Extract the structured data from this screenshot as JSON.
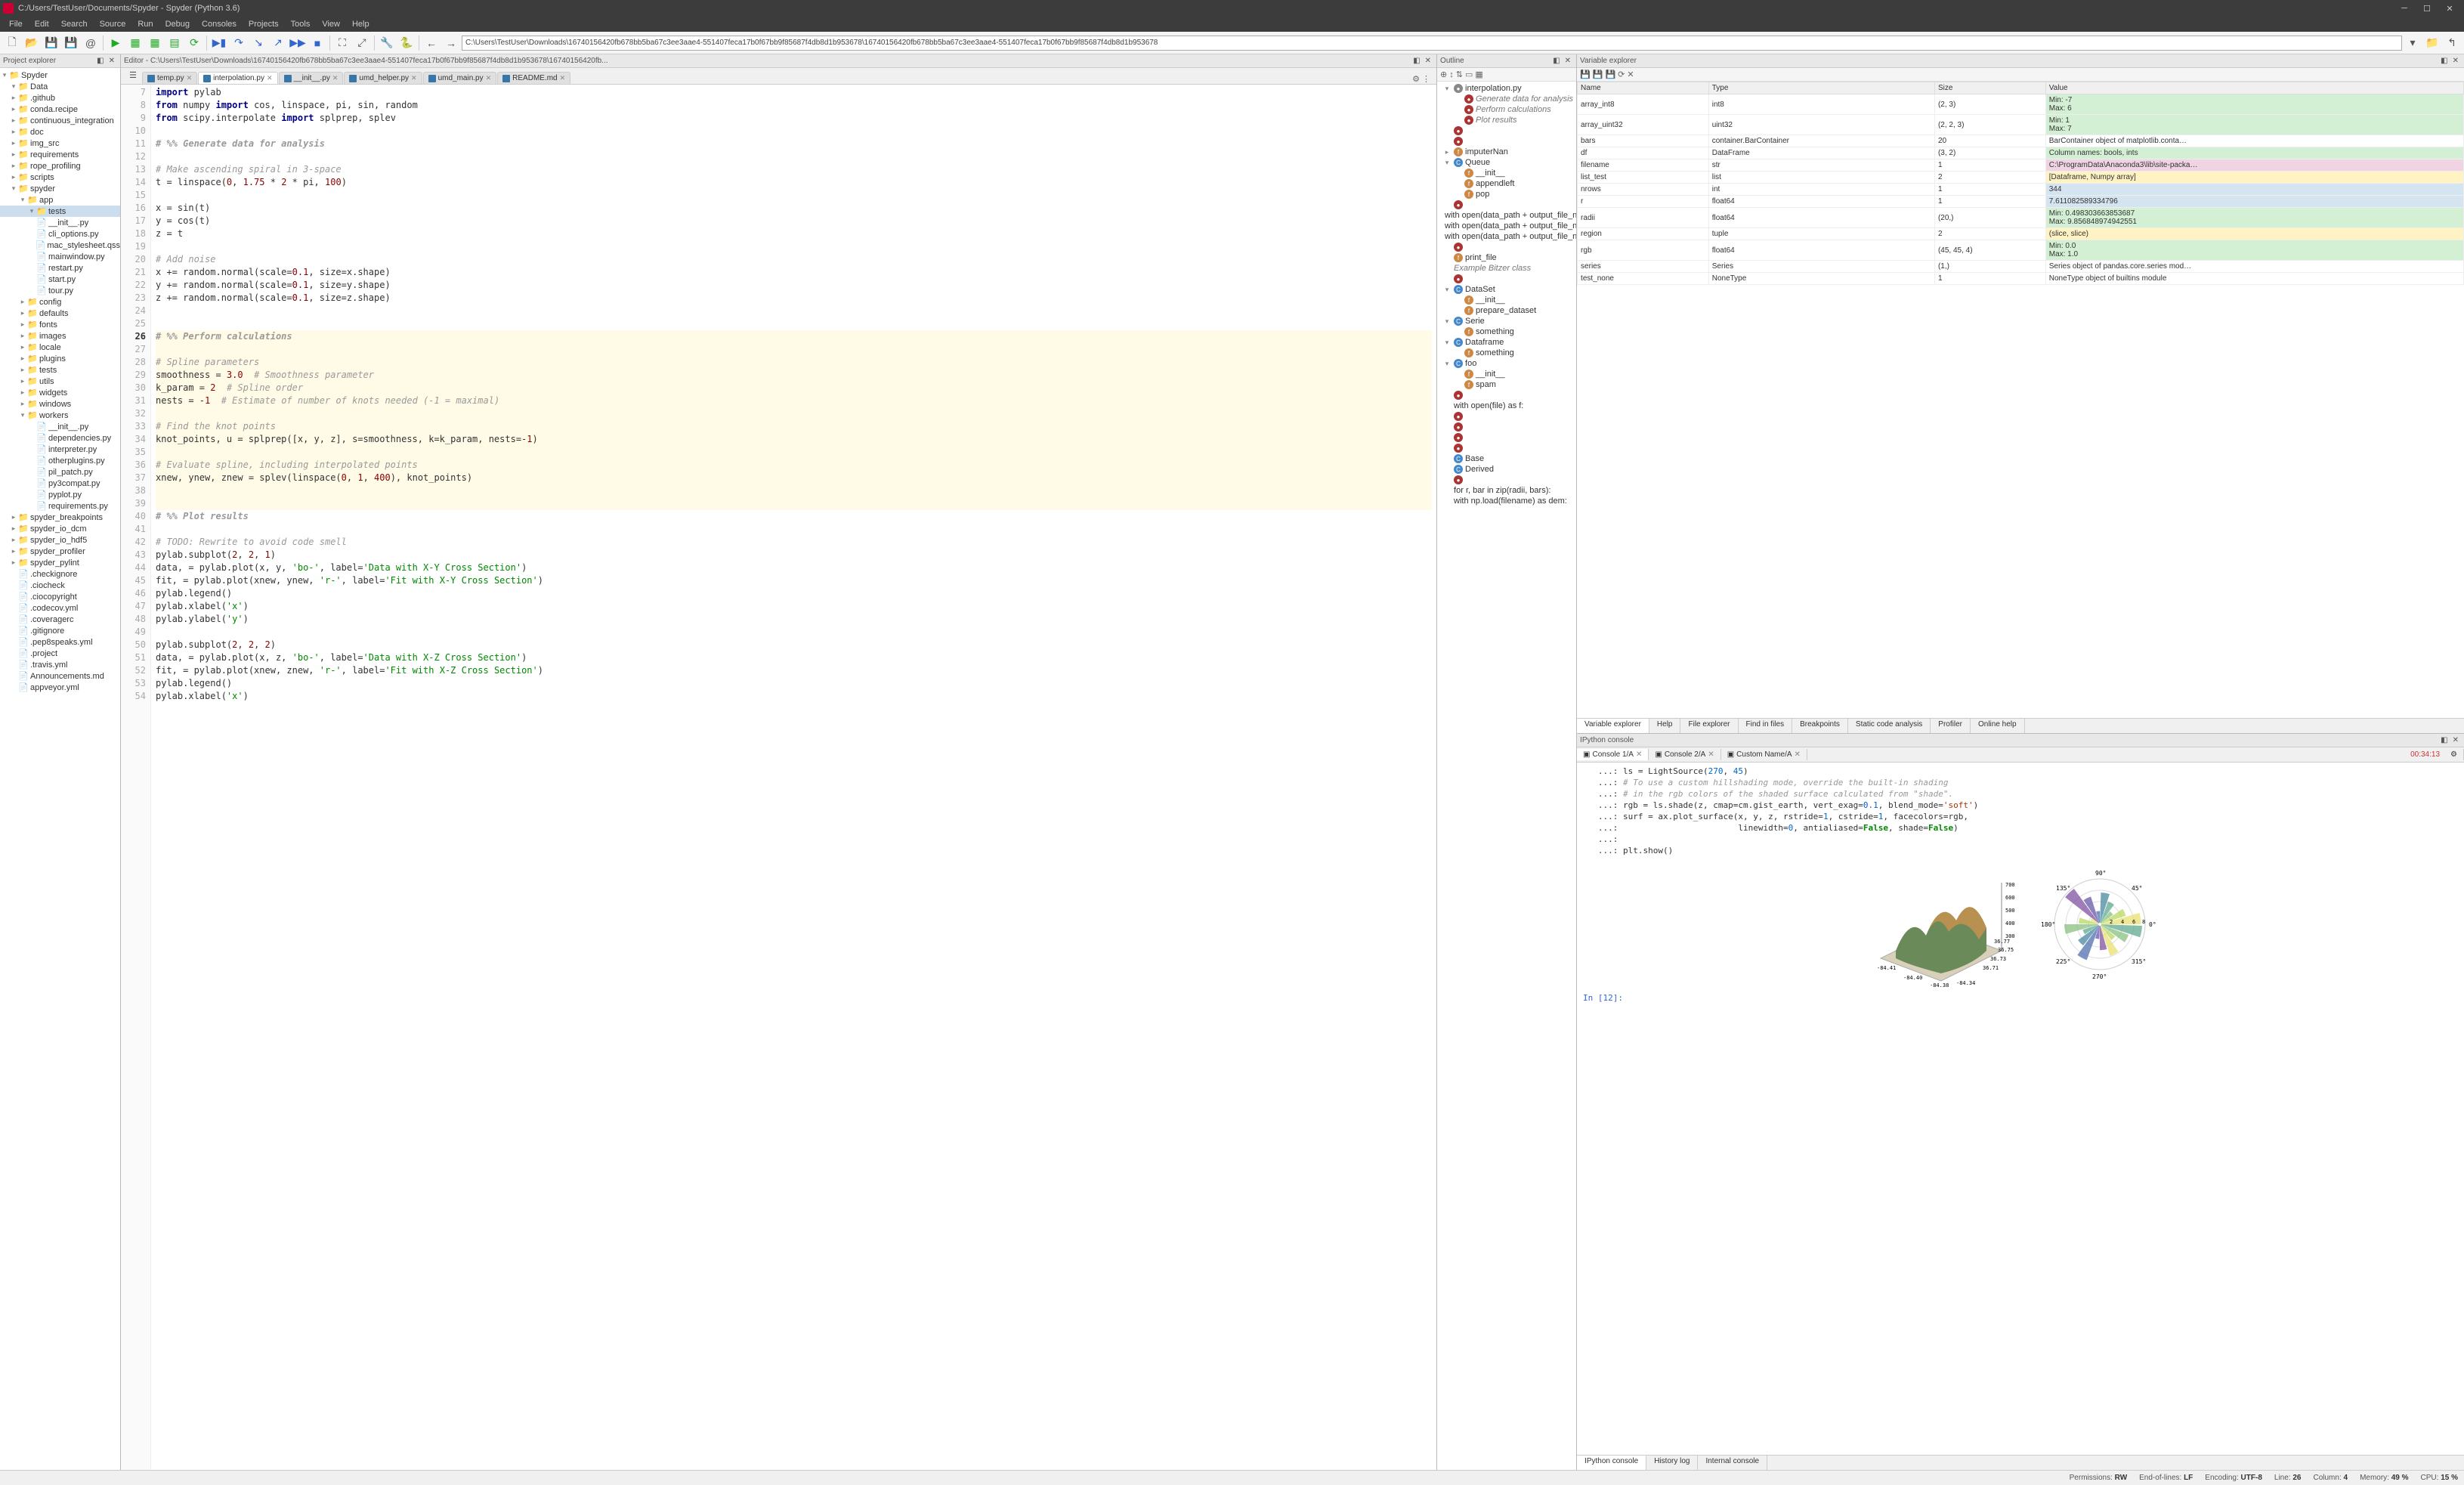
{
  "title": "C:/Users/TestUser/Documents/Spyder - Spyder (Python 3.6)",
  "menus": [
    "File",
    "Edit",
    "Search",
    "Source",
    "Run",
    "Debug",
    "Consoles",
    "Projects",
    "Tools",
    "View",
    "Help"
  ],
  "address": "C:\\Users\\TestUser\\Downloads\\16740156420fb678bb5ba67c3ee3aae4-551407feca17b0f67bb9f85687f4db8d1b953678\\16740156420fb678bb5ba67c3ee3aae4-551407feca17b0f67bb9f85687f4db8d1b953678",
  "panes": {
    "project": "Project explorer",
    "editor": "Editor - C:\\Users\\TestUser\\Downloads\\16740156420fb678bb5ba67c3ee3aae4-551407feca17b0f67bb9f85687f4db8d1b953678\\16740156420fb...",
    "outline": "Outline",
    "varexp": "Variable explorer",
    "ipython": "IPython console"
  },
  "project_tree": [
    {
      "d": 0,
      "exp": "▾",
      "icon": "folder",
      "label": "Spyder"
    },
    {
      "d": 1,
      "exp": "▾",
      "icon": "folder",
      "label": "Data"
    },
    {
      "d": 1,
      "exp": "▸",
      "icon": "folder",
      "label": ".github"
    },
    {
      "d": 1,
      "exp": "▸",
      "icon": "folder",
      "label": "conda.recipe"
    },
    {
      "d": 1,
      "exp": "▸",
      "icon": "folder",
      "label": "continuous_integration"
    },
    {
      "d": 1,
      "exp": "▸",
      "icon": "folder",
      "label": "doc"
    },
    {
      "d": 1,
      "exp": "▸",
      "icon": "folder",
      "label": "img_src"
    },
    {
      "d": 1,
      "exp": "▸",
      "icon": "folder",
      "label": "requirements"
    },
    {
      "d": 1,
      "exp": "▸",
      "icon": "folder",
      "label": "rope_profiling"
    },
    {
      "d": 1,
      "exp": "▸",
      "icon": "folder",
      "label": "scripts"
    },
    {
      "d": 1,
      "exp": "▾",
      "icon": "folder",
      "label": "spyder"
    },
    {
      "d": 2,
      "exp": "▾",
      "icon": "folder",
      "label": "app"
    },
    {
      "d": 3,
      "exp": "▾",
      "icon": "folder",
      "label": "tests",
      "sel": true
    },
    {
      "d": 3,
      "exp": "",
      "icon": "py",
      "label": "__init__.py"
    },
    {
      "d": 3,
      "exp": "",
      "icon": "py",
      "label": "cli_options.py"
    },
    {
      "d": 3,
      "exp": "",
      "icon": "file",
      "label": "mac_stylesheet.qss"
    },
    {
      "d": 3,
      "exp": "",
      "icon": "py",
      "label": "mainwindow.py"
    },
    {
      "d": 3,
      "exp": "",
      "icon": "py",
      "label": "restart.py"
    },
    {
      "d": 3,
      "exp": "",
      "icon": "py",
      "label": "start.py"
    },
    {
      "d": 3,
      "exp": "",
      "icon": "py",
      "label": "tour.py"
    },
    {
      "d": 2,
      "exp": "▸",
      "icon": "folder",
      "label": "config"
    },
    {
      "d": 2,
      "exp": "▸",
      "icon": "folder",
      "label": "defaults"
    },
    {
      "d": 2,
      "exp": "▸",
      "icon": "folder",
      "label": "fonts"
    },
    {
      "d": 2,
      "exp": "▸",
      "icon": "folder",
      "label": "images"
    },
    {
      "d": 2,
      "exp": "▸",
      "icon": "folder",
      "label": "locale"
    },
    {
      "d": 2,
      "exp": "▸",
      "icon": "folder",
      "label": "plugins"
    },
    {
      "d": 2,
      "exp": "▸",
      "icon": "folder",
      "label": "tests"
    },
    {
      "d": 2,
      "exp": "▸",
      "icon": "folder",
      "label": "utils"
    },
    {
      "d": 2,
      "exp": "▸",
      "icon": "folder",
      "label": "widgets"
    },
    {
      "d": 2,
      "exp": "▸",
      "icon": "folder",
      "label": "windows"
    },
    {
      "d": 2,
      "exp": "▾",
      "icon": "folder",
      "label": "workers"
    },
    {
      "d": 3,
      "exp": "",
      "icon": "py",
      "label": "__init__.py"
    },
    {
      "d": 3,
      "exp": "",
      "icon": "py",
      "label": "dependencies.py"
    },
    {
      "d": 3,
      "exp": "",
      "icon": "py",
      "label": "interpreter.py"
    },
    {
      "d": 3,
      "exp": "",
      "icon": "py",
      "label": "otherplugins.py"
    },
    {
      "d": 3,
      "exp": "",
      "icon": "py",
      "label": "pil_patch.py"
    },
    {
      "d": 3,
      "exp": "",
      "icon": "py",
      "label": "py3compat.py"
    },
    {
      "d": 3,
      "exp": "",
      "icon": "py",
      "label": "pyplot.py"
    },
    {
      "d": 3,
      "exp": "",
      "icon": "py",
      "label": "requirements.py"
    },
    {
      "d": 1,
      "exp": "▸",
      "icon": "folder",
      "label": "spyder_breakpoints"
    },
    {
      "d": 1,
      "exp": "▸",
      "icon": "folder",
      "label": "spyder_io_dcm"
    },
    {
      "d": 1,
      "exp": "▸",
      "icon": "folder",
      "label": "spyder_io_hdf5"
    },
    {
      "d": 1,
      "exp": "▸",
      "icon": "folder",
      "label": "spyder_profiler"
    },
    {
      "d": 1,
      "exp": "▸",
      "icon": "folder",
      "label": "spyder_pylint"
    },
    {
      "d": 1,
      "exp": "",
      "icon": "file",
      "label": ".checkignore"
    },
    {
      "d": 1,
      "exp": "",
      "icon": "file",
      "label": ".ciocheck"
    },
    {
      "d": 1,
      "exp": "",
      "icon": "file",
      "label": ".ciocopyright"
    },
    {
      "d": 1,
      "exp": "",
      "icon": "file",
      "label": ".codecov.yml"
    },
    {
      "d": 1,
      "exp": "",
      "icon": "file",
      "label": ".coveragerc"
    },
    {
      "d": 1,
      "exp": "",
      "icon": "file",
      "label": ".gitignore"
    },
    {
      "d": 1,
      "exp": "",
      "icon": "file",
      "label": ".pep8speaks.yml"
    },
    {
      "d": 1,
      "exp": "",
      "icon": "file",
      "label": ".project"
    },
    {
      "d": 1,
      "exp": "",
      "icon": "file",
      "label": ".travis.yml"
    },
    {
      "d": 1,
      "exp": "",
      "icon": "file",
      "label": "Announcements.md"
    },
    {
      "d": 1,
      "exp": "",
      "icon": "file",
      "label": "appveyor.yml"
    }
  ],
  "editor_tabs": [
    {
      "label": "temp.py"
    },
    {
      "label": "interpolation.py",
      "active": true
    },
    {
      "label": "__init__.py"
    },
    {
      "label": "umd_helper.py"
    },
    {
      "label": "umd_main.py"
    },
    {
      "label": "README.md"
    }
  ],
  "code_start_line": 7,
  "current_line": 26,
  "breakpoint_line": 34,
  "code_lines_html": [
    "<span class='kw'>import</span> pylab",
    "<span class='kw'>from</span> numpy <span class='kw'>import</span> cos, linspace, pi, sin, random",
    "<span class='kw'>from</span> scipy.interpolate <span class='kw'>import</span> splprep, splev",
    "",
    "<span class='cell'># %% Generate data for analysis</span>",
    "",
    "<span class='cmt'># Make ascending spiral in 3-space</span>",
    "t = linspace(<span class='num'>0</span>, <span class='num'>1.75</span> * <span class='num'>2</span> * pi, <span class='num'>100</span>)",
    "",
    "x = sin(t)",
    "y = cos(t)",
    "z = t",
    "",
    "<span class='cmt'># Add noise</span>",
    "x += random.normal(scale=<span class='num'>0.1</span>, size=x.shape)",
    "y += random.normal(scale=<span class='num'>0.1</span>, size=y.shape)",
    "z += random.normal(scale=<span class='num'>0.1</span>, size=z.shape)",
    "",
    "",
    "<span class='cell'># %% Perform calculations</span>",
    "",
    "<span class='cmt'># Spline parameters</span>",
    "smoothness = <span class='num'>3.0</span>  <span class='cmt'># Smoothness parameter</span>",
    "k_param = <span class='num'>2</span>  <span class='cmt'># Spline order</span>",
    "nests = -<span class='num'>1</span>  <span class='cmt'># Estimate of number of knots needed (-1 = maximal)</span>",
    "",
    "<span class='cmt'># Find the knot points</span>",
    "knot_points, u = splprep([x, y, z], s=smoothness, k=k_param, nests=-<span class='num'>1</span>)",
    "",
    "<span class='cmt'># Evaluate spline, including interpolated points</span>",
    "xnew, ynew, znew = splev(linspace(<span class='num'>0</span>, <span class='num'>1</span>, <span class='num'>400</span>), knot_points)",
    "",
    "",
    "<span class='cell'># %% Plot results</span>",
    "",
    "<span class='cmt'># TODO: Rewrite to avoid code smell</span>",
    "pylab.subplot(<span class='num'>2</span>, <span class='num'>2</span>, <span class='num'>1</span>)",
    "data, = pylab.plot(x, y, <span class='str'>'bo-'</span>, label=<span class='str'>'Data with X-Y Cross Section'</span>)",
    "fit, = pylab.plot(xnew, ynew, <span class='str'>'r-'</span>, label=<span class='str'>'Fit with X-Y Cross Section'</span>)",
    "pylab.legend()",
    "pylab.xlabel(<span class='str'>'x'</span>)",
    "pylab.ylabel(<span class='str'>'y'</span>)",
    "",
    "pylab.subplot(<span class='num'>2</span>, <span class='num'>2</span>, <span class='num'>2</span>)",
    "data, = pylab.plot(x, z, <span class='str'>'bo-'</span>, label=<span class='str'>'Data with X-Z Cross Section'</span>)",
    "fit, = pylab.plot(xnew, znew, <span class='str'>'r-'</span>, label=<span class='str'>'Fit with X-Z Cross Section'</span>)",
    "pylab.legend()",
    "pylab.xlabel(<span class='str'>'x'</span>)"
  ],
  "outline": [
    {
      "d": 0,
      "exp": "▾",
      "ic": "f",
      "label": "interpolation.py"
    },
    {
      "d": 1,
      "ic": "cell",
      "label": "Generate data for analysis",
      "it": true
    },
    {
      "d": 1,
      "ic": "cell",
      "label": "Perform calculations",
      "it": true
    },
    {
      "d": 1,
      "ic": "cell",
      "label": "Plot results",
      "it": true
    },
    {
      "d": 0,
      "ic": "cell",
      "label": ""
    },
    {
      "d": 0,
      "ic": "cell",
      "label": ""
    },
    {
      "d": 0,
      "exp": "▸",
      "ic": "m",
      "label": "imputerNan"
    },
    {
      "d": 0,
      "exp": "▾",
      "ic": "c",
      "label": "Queue"
    },
    {
      "d": 1,
      "ic": "m",
      "label": "__init__"
    },
    {
      "d": 1,
      "ic": "m",
      "label": "appendleft"
    },
    {
      "d": 1,
      "ic": "m",
      "label": "pop"
    },
    {
      "d": 0,
      "ic": "cell",
      "label": ""
    },
    {
      "d": 0,
      "label": "with open(data_path + output_file_n..."
    },
    {
      "d": 0,
      "label": "with open(data_path + output_file_n..."
    },
    {
      "d": 0,
      "label": "with open(data_path + output_file_n..."
    },
    {
      "d": 0,
      "ic": "cell",
      "label": ""
    },
    {
      "d": 0,
      "ic": "m",
      "label": "print_file"
    },
    {
      "d": 0,
      "label": "Example Bitzer class",
      "it": true
    },
    {
      "d": 0,
      "ic": "cell",
      "label": ""
    },
    {
      "d": 0,
      "exp": "▾",
      "ic": "c",
      "label": "DataSet"
    },
    {
      "d": 1,
      "ic": "m",
      "label": "__init__"
    },
    {
      "d": 1,
      "ic": "m",
      "label": "prepare_dataset"
    },
    {
      "d": 0,
      "exp": "▾",
      "ic": "c",
      "label": "Serie"
    },
    {
      "d": 1,
      "ic": "m",
      "label": "something"
    },
    {
      "d": 0,
      "exp": "▾",
      "ic": "c",
      "label": "Dataframe"
    },
    {
      "d": 1,
      "ic": "m",
      "label": "something"
    },
    {
      "d": 0,
      "exp": "▾",
      "ic": "c",
      "label": "foo"
    },
    {
      "d": 1,
      "ic": "m",
      "label": "__init__"
    },
    {
      "d": 1,
      "ic": "m",
      "label": "spam"
    },
    {
      "d": 0,
      "ic": "cell",
      "label": ""
    },
    {
      "d": 0,
      "label": "with open(file) as f:"
    },
    {
      "d": 0,
      "ic": "cell",
      "label": ""
    },
    {
      "d": 0,
      "ic": "cell",
      "label": ""
    },
    {
      "d": 0,
      "ic": "cell",
      "label": ""
    },
    {
      "d": 0,
      "ic": "cell",
      "label": ""
    },
    {
      "d": 0,
      "ic": "c",
      "label": "Base"
    },
    {
      "d": 0,
      "ic": "c",
      "label": "Derived"
    },
    {
      "d": 0,
      "ic": "cell",
      "label": ""
    },
    {
      "d": 0,
      "label": "for r, bar in zip(radii, bars):"
    },
    {
      "d": 0,
      "label": "with np.load(filename) as dem:"
    }
  ],
  "varexp_headers": [
    "Name",
    "Type",
    "Size",
    "Value"
  ],
  "variables": [
    {
      "n": "array_int8",
      "t": "int8",
      "s": "(2, 3)",
      "v": "Min: -7\nMax: 6",
      "cls": "g"
    },
    {
      "n": "array_uint32",
      "t": "uint32",
      "s": "(2, 2, 3)",
      "v": "Min: 1\nMax: 7",
      "cls": "g"
    },
    {
      "n": "bars",
      "t": "container.BarContainer",
      "s": "20",
      "v": "BarContainer object of matplotlib.conta…",
      "cls": ""
    },
    {
      "n": "df",
      "t": "DataFrame",
      "s": "(3, 2)",
      "v": "Column names: bools, ints",
      "cls": "g"
    },
    {
      "n": "filename",
      "t": "str",
      "s": "1",
      "v": "C:\\ProgramData\\Anaconda3\\lib\\site-packa…",
      "cls": "p"
    },
    {
      "n": "list_test",
      "t": "list",
      "s": "2",
      "v": "[Dataframe, Numpy array]",
      "cls": "y"
    },
    {
      "n": "nrows",
      "t": "int",
      "s": "1",
      "v": "344",
      "cls": "b"
    },
    {
      "n": "r",
      "t": "float64",
      "s": "1",
      "v": "7.611082589334796",
      "cls": "b"
    },
    {
      "n": "radii",
      "t": "float64",
      "s": "(20,)",
      "v": "Min: 0.498303663853687\nMax: 9.856848974942551",
      "cls": "g"
    },
    {
      "n": "region",
      "t": "tuple",
      "s": "2",
      "v": "(slice, slice)",
      "cls": "y"
    },
    {
      "n": "rgb",
      "t": "float64",
      "s": "(45, 45, 4)",
      "v": "Min: 0.0\nMax: 1.0",
      "cls": "g"
    },
    {
      "n": "series",
      "t": "Series",
      "s": "(1,)",
      "v": "Series object of pandas.core.series mod…",
      "cls": ""
    },
    {
      "n": "test_none",
      "t": "NoneType",
      "s": "1",
      "v": "NoneType object of builtins module",
      "cls": ""
    }
  ],
  "varexp_tabs": [
    "Variable explorer",
    "Help",
    "File explorer",
    "Find in files",
    "Breakpoints",
    "Static code analysis",
    "Profiler",
    "Online help"
  ],
  "console_tabs": [
    {
      "label": "Console 1/A",
      "active": true
    },
    {
      "label": "Console 2/A"
    },
    {
      "label": "Custom Name/A"
    }
  ],
  "console_time": "00:34:13",
  "console_lines_html": [
    "   ...: ls = LightSource(<span class='num2'>270</span>, <span class='num2'>45</span>)",
    "   ...: <span class='cmt'># To use a custom hillshading mode, override the built-in shading</span>",
    "   ...: <span class='cmt'># in the rgb colors of the shaded surface calculated from \"shade\".</span>",
    "   ...: rgb = ls.shade(z, cmap=cm.gist_earth, vert_exag=<span class='num2'>0.1</span>, blend_mode=<span class='str2'>'soft'</span>)",
    "   ...: surf = ax.plot_surface(x, y, z, rstride=<span class='num2'>1</span>, cstride=<span class='num2'>1</span>, facecolors=rgb,",
    "   ...:                        linewidth=<span class='num2'>0</span>, antialiased=<span class='kw2'>False</span>, shade=<span class='kw2'>False</span>)",
    "   ...: ",
    "   ...: plt.show()"
  ],
  "console_prompt": "In [12]:",
  "console_bottom_tabs": [
    "IPython console",
    "History log",
    "Internal console"
  ],
  "chart_data": [
    {
      "type": "surface3d",
      "title": "",
      "x_range": [
        -84.41,
        -84.34
      ],
      "y_range": [
        36.71,
        36.77
      ],
      "z_range": [
        250,
        700
      ],
      "x_ticks": [
        -84.41,
        -84.4,
        -84.38,
        -84.34
      ],
      "y_ticks": [
        36.71,
        36.73,
        36.75,
        36.77
      ],
      "z_ticks": [
        300,
        400,
        500,
        600,
        700
      ],
      "colormap": "gist_earth"
    },
    {
      "type": "polar_bar",
      "angle_ticks_deg": [
        0,
        45,
        90,
        135,
        180,
        225,
        270,
        315
      ],
      "radial_ticks": [
        2,
        4,
        6,
        8
      ],
      "n_bars": 20,
      "bar_heights_est": [
        7.8,
        5.2,
        3.1,
        4.6,
        6.0,
        2.5,
        5.5,
        8.3,
        1.9,
        4.0,
        6.7,
        3.4,
        5.1,
        7.2,
        2.8,
        4.9,
        6.3,
        3.7,
        5.8,
        8.0
      ]
    }
  ],
  "status": {
    "permissions": "RW",
    "eol": "LF",
    "encoding": "UTF-8",
    "line": "26",
    "column": "4",
    "memory": "49 %",
    "cpu": "15 %"
  }
}
